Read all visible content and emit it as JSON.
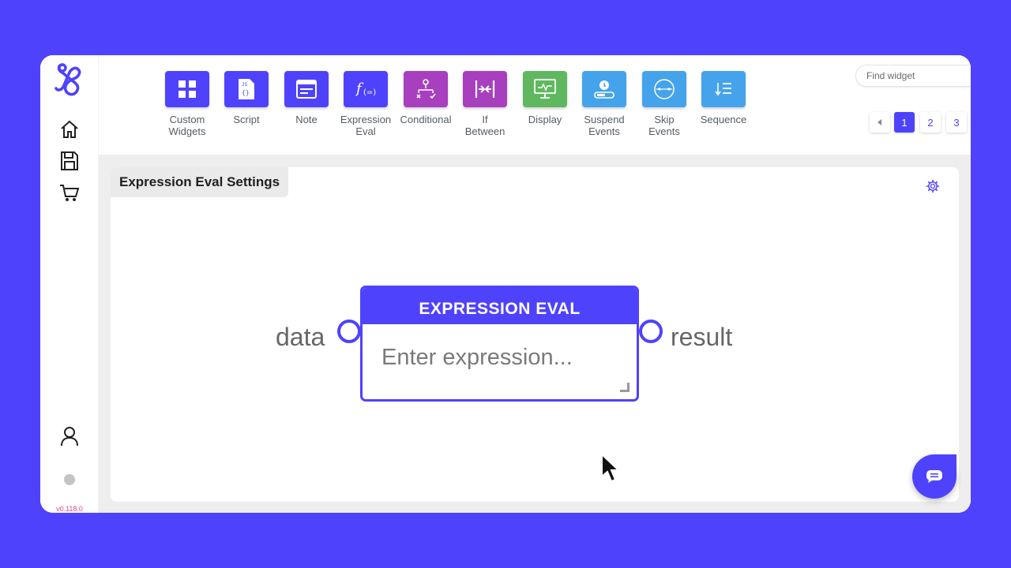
{
  "app": {
    "version": "v0.118.0",
    "accent": "#4f42fd"
  },
  "sidebar": {
    "items": [
      {
        "name": "home",
        "icon": "home-icon"
      },
      {
        "name": "save",
        "icon": "save-icon"
      },
      {
        "name": "store",
        "icon": "cart-icon"
      },
      {
        "name": "account",
        "icon": "user-icon"
      }
    ]
  },
  "toolbar": {
    "widgets": [
      {
        "label": "Custom\nWidgets",
        "color": "#4f42fd",
        "icon": "grid-icon"
      },
      {
        "label": "Script",
        "color": "#4f42fd",
        "icon": "script-icon"
      },
      {
        "label": "Note",
        "color": "#4f42fd",
        "icon": "note-icon"
      },
      {
        "label": "Expression\nEval",
        "color": "#4f42fd",
        "icon": "function-icon"
      },
      {
        "label": "Conditional",
        "color": "#a73fbf",
        "icon": "branch-icon"
      },
      {
        "label": "If\nBetween",
        "color": "#a73fbf",
        "icon": "between-icon"
      },
      {
        "label": "Display",
        "color": "#5fb85f",
        "icon": "monitor-icon"
      },
      {
        "label": "Suspend\nEvents",
        "color": "#45a3ec",
        "icon": "timer-icon"
      },
      {
        "label": "Skip\nEvents",
        "color": "#45a3ec",
        "icon": "skip-icon"
      },
      {
        "label": "Sequence",
        "color": "#45a3ec",
        "icon": "sequence-icon"
      }
    ],
    "search": {
      "placeholder": "Find widget"
    },
    "pagination": {
      "pages": [
        "1",
        "2",
        "3"
      ],
      "current": "1"
    }
  },
  "panel": {
    "title": "Expression Eval Settings",
    "node": {
      "title": "EXPRESSION EVAL",
      "placeholder": "Enter expression...",
      "input_label": "data",
      "output_label": "result"
    }
  }
}
